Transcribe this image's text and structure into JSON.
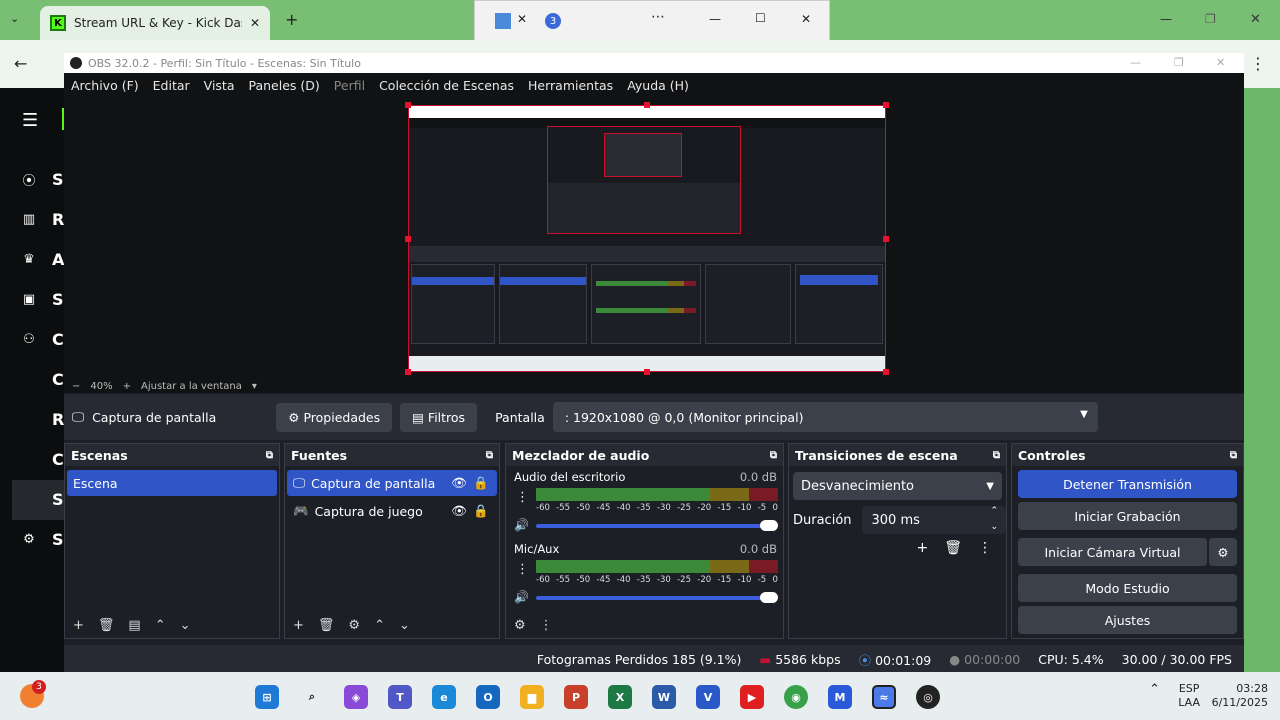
{
  "browser": {
    "tab_title": "Stream URL & Key - Kick Dashb",
    "popup_badge": "3"
  },
  "obs": {
    "window_title": "OBS 32.0.2 - Perfil: Sin Título - Escenas: Sin Título",
    "menu": [
      "Archivo (F)",
      "Editar",
      "Vista",
      "Paneles (D)",
      "Perfil",
      "Colección de Escenas",
      "Herramientas",
      "Ayuda (H)"
    ],
    "zoom": {
      "minus": "−",
      "value": "40%",
      "plus": "+",
      "fit": "Ajustar a la ventana"
    },
    "source_bar": {
      "source": "Captura de pantalla",
      "properties": "Propiedades",
      "filters": "Filtros",
      "display_label": "Pantalla",
      "display_value": ": 1920x1080 @ 0,0 (Monitor principal)"
    },
    "scenes": {
      "title": "Escenas",
      "items": [
        "Escena"
      ]
    },
    "sources": {
      "title": "Fuentes",
      "items": [
        "Captura de pantalla",
        "Captura de juego"
      ]
    },
    "mixer": {
      "title": "Mezclador de audio",
      "channels": [
        {
          "name": "Audio del escritorio",
          "db": "0.0 dB"
        },
        {
          "name": "Mic/Aux",
          "db": "0.0 dB"
        }
      ],
      "scale": [
        "-60",
        "-55",
        "-50",
        "-45",
        "-40",
        "-35",
        "-30",
        "-25",
        "-20",
        "-15",
        "-10",
        "-5",
        "0"
      ]
    },
    "transitions": {
      "title": "Transiciones de escena",
      "type": "Desvanecimiento",
      "duration_label": "Duración",
      "duration_value": "300 ms"
    },
    "controls": {
      "title": "Controles",
      "stop_stream": "Detener Transmisión",
      "start_rec": "Iniciar Grabación",
      "start_vcam": "Iniciar Cámara Virtual",
      "studio": "Modo Estudio",
      "settings": "Ajustes"
    },
    "status": {
      "dropped": "Fotogramas Perdidos 185 (9.1%)",
      "bitrate": "5586 kbps",
      "live_time": "00:01:09",
      "rec_time": "00:00:00",
      "cpu": "CPU: 5.4%",
      "fps": "30.00 / 30.00 FPS"
    }
  },
  "left_nav_letters": [
    "S",
    "R",
    "A",
    "S",
    "C",
    "C",
    "R",
    "C",
    "S",
    "S"
  ],
  "taskbar": {
    "lang1": "ESP",
    "lang2": "LAA",
    "time": "03:28",
    "date": "6/11/2025",
    "notif_badge": "3"
  }
}
